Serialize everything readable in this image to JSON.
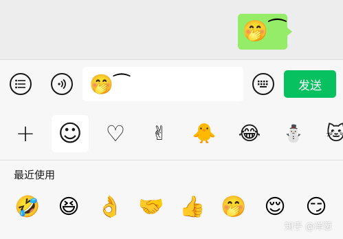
{
  "chat": {
    "sent_bubble": {
      "content": "🤭 ⁀",
      "bg_color": "#95ec69"
    }
  },
  "input_bar": {
    "list_icon": "list-icon",
    "voice_icon": "voice-icon",
    "draft_text": "🤭 ⁀",
    "keyboard_icon": "keyboard-icon",
    "send_label": "发送",
    "send_color": "#07c160"
  },
  "sticker_tabs": [
    {
      "name": "add-tab",
      "glyph": "+"
    },
    {
      "name": "emoji-tab",
      "glyph": "☺",
      "active": true
    },
    {
      "name": "favorites-tab",
      "glyph": "♡"
    },
    {
      "name": "gesture-sticker-tab",
      "glyph": "✌"
    },
    {
      "name": "chick-sticker-tab",
      "glyph": "🐥"
    },
    {
      "name": "laughing-sticker-tab",
      "glyph": "😂"
    },
    {
      "name": "doll-sticker-tab",
      "glyph": "⛄"
    },
    {
      "name": "cat-sticker-tab",
      "glyph": "🐱"
    }
  ],
  "emoji_panel": {
    "section_label": "最近使用",
    "recent": [
      "🤣",
      "😆",
      "👌",
      "🤝",
      "👍",
      "🤭",
      "😌",
      "😏"
    ]
  },
  "watermark": "知乎 @洋葱"
}
